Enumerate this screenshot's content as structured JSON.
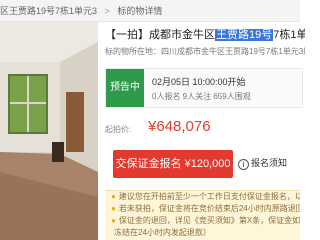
{
  "breadcrumb": {
    "items": [
      "区王贾路19号7栋1单元3",
      "标的物详情"
    ],
    "separator": ">"
  },
  "title": {
    "prefix": "【一拍】成都市金牛区",
    "highlight": "王贾路19号",
    "suffix": "7栋1单元3层3"
  },
  "address": "标的物所在地：四川成都市金牛区王贾路19号7栋1单元3层302号",
  "status": {
    "badge": "预告中",
    "start_time": "02月05日 10:00:00开始",
    "counts": "0人报名  9人关注  659人围观"
  },
  "price": {
    "label": "起拍价:",
    "value": "¥648,076"
  },
  "actions": {
    "signup": "交保证金报名 ¥120,000",
    "signup_status": "报名须知"
  },
  "notices": [
    "建议您在开拍前至少一个工作日支付保证金报名，以免",
    "若未获拍，保证金将在竞价结束后24小时内原路退回",
    "保证金的退回，详见《竞买须知》第X条，保证金如在",
    "冻结在24小时内发起退款）"
  ],
  "icons": {
    "notice": "bulb-icon",
    "info": "info-circle-icon"
  },
  "colors": {
    "badge": "#2e9a4a",
    "price": "#e33b2c",
    "button": "#e23a2f",
    "highlight": "#3a78d8"
  }
}
